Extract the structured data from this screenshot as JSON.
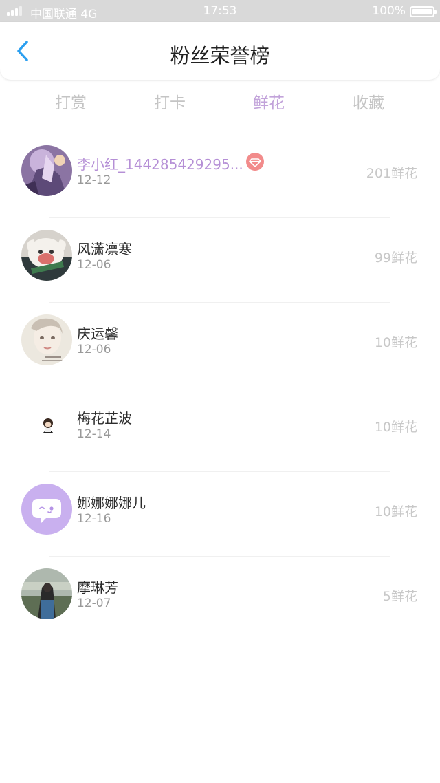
{
  "status_bar": {
    "carrier": "中国联通   4G",
    "time": "17:53",
    "battery": "100%"
  },
  "header": {
    "title": "粉丝荣誉榜",
    "back_icon": "chevron-left-icon"
  },
  "tabs": [
    {
      "label": "打赏",
      "active": false
    },
    {
      "label": "打卡",
      "active": false
    },
    {
      "label": "鲜花",
      "active": true
    },
    {
      "label": "收藏",
      "active": false
    }
  ],
  "fans": [
    {
      "name": "李小红_144285429295...",
      "date": "12-12",
      "count": "201鲜花",
      "highlight": true,
      "badge": "diamond-icon"
    },
    {
      "name": "风潇凛寒",
      "date": "12-06",
      "count": "99鲜花"
    },
    {
      "name": "庆运馨",
      "date": "12-06",
      "count": "10鲜花"
    },
    {
      "name": "梅花芷波",
      "date": "12-14",
      "count": "10鲜花"
    },
    {
      "name": "娜娜娜娜儿",
      "date": "12-16",
      "count": "10鲜花"
    },
    {
      "name": "摩琳芳",
      "date": "12-07",
      "count": "5鲜花"
    }
  ],
  "colors": {
    "accent": "#2b9ff0",
    "active_tab": "#c2a3da",
    "highlight_name": "#b58fd6",
    "badge": "#f28b8b"
  }
}
